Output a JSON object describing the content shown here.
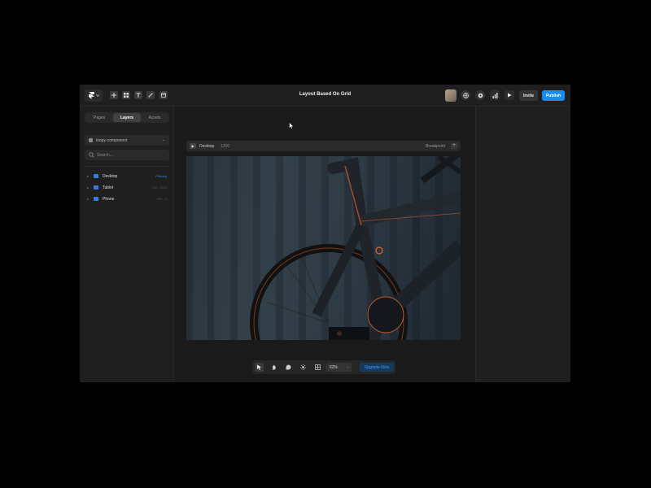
{
  "window": {
    "title": "Layout Based On Grid"
  },
  "topbar": {
    "tools": [
      "insert-icon",
      "grid-icon",
      "text-icon",
      "pen-icon",
      "database-icon"
    ],
    "right_icons": [
      "globe-icon",
      "settings-icon",
      "analytics-icon",
      "play-icon"
    ],
    "invite_label": "Invite",
    "publish_label": "Publish"
  },
  "sidebar": {
    "tabs": [
      {
        "label": "Pages",
        "active": false
      },
      {
        "label": "Layers",
        "active": true
      },
      {
        "label": "Assets",
        "active": false
      }
    ],
    "component_select": "loopy-component",
    "search_placeholder": "Search...",
    "layers": [
      {
        "name": "Desktop",
        "meta": "Primary"
      },
      {
        "name": "Tablet",
        "meta": "768 - 1199"
      },
      {
        "name": "Phone",
        "meta": "809 - 0"
      }
    ]
  },
  "canvas": {
    "breakpoint_bar": {
      "device": "Desktop",
      "width": "1200",
      "breakpoint_label": "Breakpoint",
      "add_symbol": "+"
    },
    "hero_image": "bicycle-photo"
  },
  "toolbar": {
    "tools": [
      "pointer-icon",
      "hand-icon",
      "comment-icon",
      "sun-icon",
      "grid-icon"
    ],
    "zoom": "62%",
    "upgrade_label": "Upgrade Now"
  },
  "colors": {
    "accent": "#1a8cf0",
    "background": "#1b1b1b",
    "panel": "#1f1f1f"
  }
}
